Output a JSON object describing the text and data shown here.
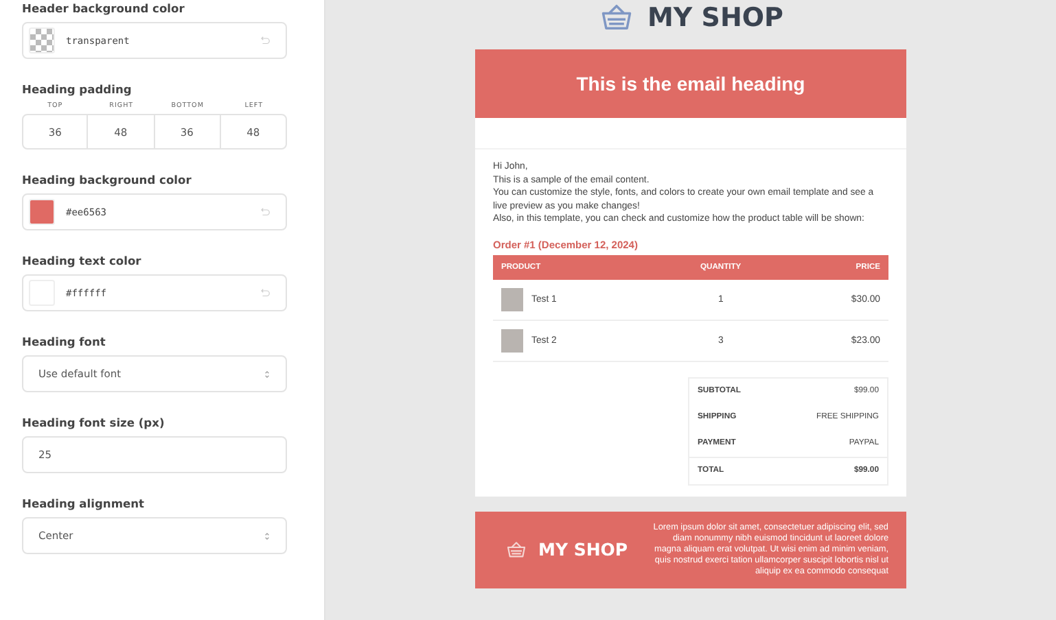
{
  "settings": [
    {
      "kind": "color",
      "label": "Header background color",
      "value": "transparent"
    },
    {
      "kind": "padding",
      "label": "Heading padding",
      "sides": [
        {
          "label": "TOP",
          "value": "36"
        },
        {
          "label": "RIGHT",
          "value": "48"
        },
        {
          "label": "BOTTOM",
          "value": "36"
        },
        {
          "label": "LEFT",
          "value": "48"
        }
      ]
    },
    {
      "kind": "color",
      "label": "Heading background color",
      "value": "#ee6563",
      "color": "#e06a64"
    },
    {
      "kind": "color",
      "label": "Heading text color",
      "value": "#ffffff",
      "color": "#ffffff"
    },
    {
      "kind": "select",
      "label": "Heading font",
      "value": "Use default font"
    },
    {
      "kind": "number",
      "label": "Heading font size (px)",
      "value": "25"
    },
    {
      "kind": "select",
      "label": "Heading alignment",
      "value": "Center"
    }
  ],
  "preview": {
    "logo": "MY SHOP",
    "heading": "This is the email heading",
    "body": [
      "Hi John,",
      "This is a sample of the email content.",
      "You can customize the style, fonts, and colors to create your own email template and see a live preview as you make changes!",
      "Also, in this template, you can check and customize how the product table will be shown:"
    ],
    "order_title": "Order #1 (December 12, 2024)",
    "columns": [
      "PRODUCT",
      "QUANTITY",
      "PRICE"
    ],
    "rows": [
      {
        "product": "Test 1",
        "quantity": "1",
        "price": "$30.00"
      },
      {
        "product": "Test 2",
        "quantity": "3",
        "price": "$23.00"
      }
    ],
    "totals": [
      {
        "label": "SUBTOTAL",
        "value": "$99.00",
        "bold": false
      },
      {
        "label": "SHIPPING",
        "value": "FREE SHIPPING",
        "bold": false
      },
      {
        "label": "PAYMENT",
        "value": "PAYPAL",
        "bold": false
      },
      {
        "label": "TOTAL",
        "value": "$99.00",
        "bold": true
      }
    ],
    "footer": {
      "logo": "MY SHOP",
      "text": "Lorem ipsum dolor sit amet, consectetuer adipiscing elit, sed diam nonummy nibh euismod tincidunt ut laoreet dolore magna aliquam erat volutpat. Ut wisi enim ad minim veniam, quis nostrud exerci tation ullamcorper suscipit lobortis nisl ut aliquip ex ea commodo consequat"
    }
  }
}
